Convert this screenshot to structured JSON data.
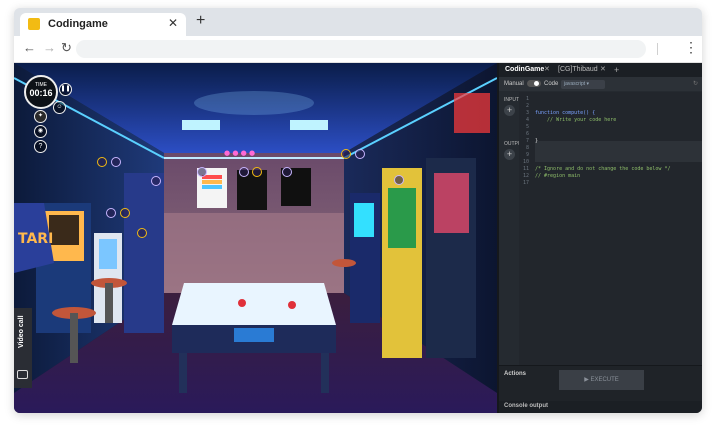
{
  "browser": {
    "tab_title": "Codingame",
    "tab_close": "✕",
    "new_tab": "+",
    "back": "←",
    "forward": "→",
    "reload": "↻",
    "menu": "⋮"
  },
  "hud": {
    "timer_label": "TIME",
    "timer_value": "00:16",
    "pause_icon": "pause-icon",
    "help": "?"
  },
  "video_call": {
    "label": "Video call"
  },
  "ide": {
    "tabs": [
      {
        "label": "CodinGame",
        "active": true
      },
      {
        "label": "[CG]Thibaud",
        "active": false
      }
    ],
    "tab_close": "✕",
    "add_tab": "+",
    "manual_label": "Manual",
    "code_label": "Code",
    "language": "javascript",
    "input_label": "INPUT",
    "output_label": "OUTPUT",
    "code_lines": [
      {
        "n": "1",
        "text": ""
      },
      {
        "n": "2",
        "text": ""
      },
      {
        "n": "3",
        "text": "function compute() {"
      },
      {
        "n": "4",
        "text": "    // Write your code here"
      },
      {
        "n": "5",
        "text": ""
      },
      {
        "n": "6",
        "text": ""
      },
      {
        "n": "7",
        "text": "}"
      },
      {
        "n": "8",
        "text": ""
      },
      {
        "n": "9",
        "text": ""
      },
      {
        "n": "10",
        "text": ""
      },
      {
        "n": "11",
        "text": "/* Ignore and do not change the code below */"
      },
      {
        "n": "12",
        "text": "// #region main"
      },
      {
        "n": "17",
        "text": ""
      }
    ],
    "actions_title": "Actions",
    "execute_label": "▶  EXECUTE",
    "console_title": "Console output"
  },
  "colors": {
    "brand": "#f2bb13",
    "ide_bg": "#252a30",
    "code_keyword": "#7aa2ff",
    "code_comment": "#8fbf6a"
  }
}
